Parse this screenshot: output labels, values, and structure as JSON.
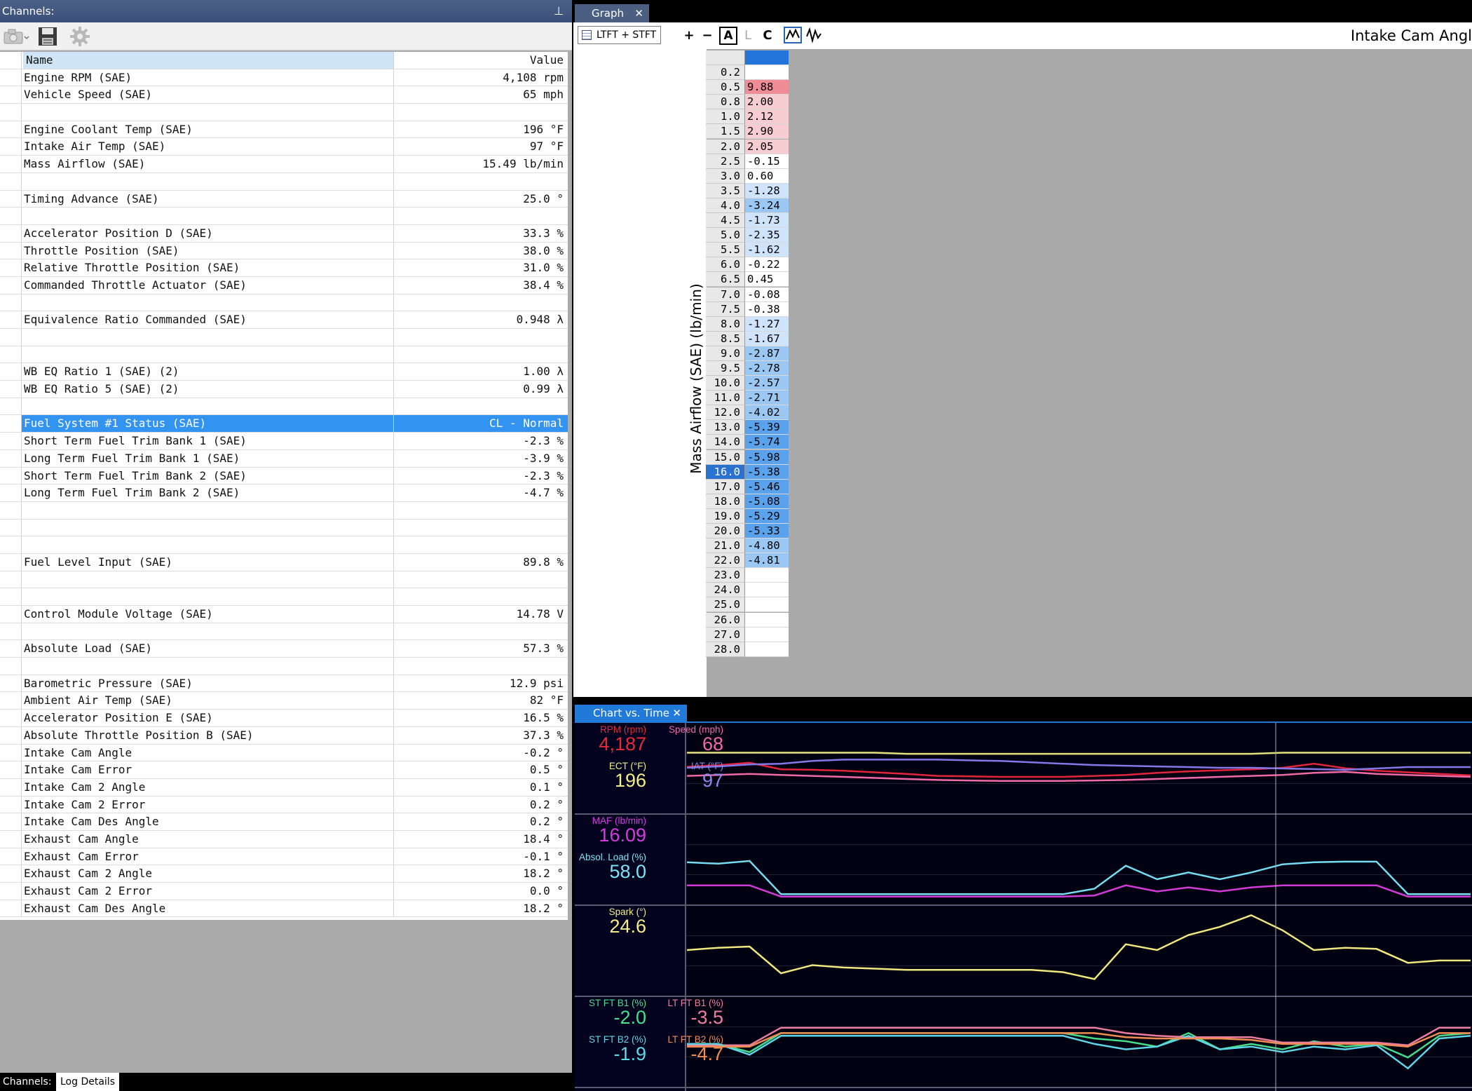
{
  "channels": {
    "title": "Channels:",
    "pin_glyph": "⊥",
    "toolbar_icons": [
      "camera-icon",
      "save-icon",
      "gear-icon"
    ],
    "header": {
      "name": "Name",
      "value": "Value"
    },
    "rows": [
      {
        "name": "Engine RPM (SAE)",
        "value": "4,108 rpm"
      },
      {
        "name": "Vehicle Speed (SAE)",
        "value": "65 mph"
      },
      {
        "name": "",
        "value": ""
      },
      {
        "name": "Engine Coolant Temp (SAE)",
        "value": "196 °F"
      },
      {
        "name": "Intake Air Temp (SAE)",
        "value": "97 °F"
      },
      {
        "name": "Mass Airflow (SAE)",
        "value": "15.49 lb/min"
      },
      {
        "name": "",
        "value": ""
      },
      {
        "name": "Timing Advance (SAE)",
        "value": "25.0 °"
      },
      {
        "name": "",
        "value": ""
      },
      {
        "name": "Accelerator Position D (SAE)",
        "value": "33.3 %"
      },
      {
        "name": "Throttle Position (SAE)",
        "value": "38.0 %"
      },
      {
        "name": "Relative Throttle Position (SAE)",
        "value": "31.0 %"
      },
      {
        "name": "Commanded Throttle Actuator (SAE)",
        "value": "38.4 %"
      },
      {
        "name": "",
        "value": ""
      },
      {
        "name": "Equivalence Ratio Commanded (SAE)",
        "value": "0.948 λ"
      },
      {
        "name": "",
        "value": ""
      },
      {
        "name": "",
        "value": ""
      },
      {
        "name": "WB EQ Ratio 1 (SAE) (2)",
        "value": "1.00 λ"
      },
      {
        "name": "WB EQ Ratio 5 (SAE) (2)",
        "value": "0.99 λ"
      },
      {
        "name": "",
        "value": ""
      },
      {
        "name": "Fuel System #1 Status (SAE)",
        "value": "CL - Normal",
        "selected": true
      },
      {
        "name": "Short Term Fuel Trim Bank 1 (SAE)",
        "value": "-2.3 %"
      },
      {
        "name": "Long Term Fuel Trim Bank 1 (SAE)",
        "value": "-3.9 %"
      },
      {
        "name": "Short Term Fuel Trim Bank 2 (SAE)",
        "value": "-2.3 %"
      },
      {
        "name": "Long Term Fuel Trim Bank 2 (SAE)",
        "value": "-4.7 %"
      },
      {
        "name": "",
        "value": ""
      },
      {
        "name": "",
        "value": ""
      },
      {
        "name": "",
        "value": ""
      },
      {
        "name": "Fuel Level Input (SAE)",
        "value": "89.8 %"
      },
      {
        "name": "",
        "value": ""
      },
      {
        "name": "",
        "value": ""
      },
      {
        "name": "Control Module Voltage (SAE)",
        "value": "14.78 V"
      },
      {
        "name": "",
        "value": ""
      },
      {
        "name": "Absolute Load (SAE)",
        "value": "57.3 %"
      },
      {
        "name": "",
        "value": ""
      },
      {
        "name": "Barometric Pressure (SAE)",
        "value": "12.9 psi"
      },
      {
        "name": "Ambient Air Temp (SAE)",
        "value": "82 °F"
      },
      {
        "name": "Accelerator Position E (SAE)",
        "value": "16.5 %"
      },
      {
        "name": "Absolute Throttle Position B (SAE)",
        "value": "37.3 %"
      },
      {
        "name": "Intake Cam Angle",
        "value": "-0.2 °"
      },
      {
        "name": "Intake Cam Error",
        "value": "0.5 °"
      },
      {
        "name": "Intake Cam 2 Angle",
        "value": "0.1 °"
      },
      {
        "name": "Intake Cam 2 Error",
        "value": "0.2 °"
      },
      {
        "name": "Intake Cam Des Angle",
        "value": "0.2 °"
      },
      {
        "name": "Exhaust Cam Angle",
        "value": "18.4 °"
      },
      {
        "name": "Exhaust Cam Error",
        "value": "-0.1 °"
      },
      {
        "name": "Exhaust Cam 2 Angle",
        "value": "18.2 °"
      },
      {
        "name": "Exhaust Cam 2 Error",
        "value": "0.0 °"
      },
      {
        "name": "Exhaust Cam Des Angle",
        "value": "18.2 °"
      }
    ],
    "bottom_tabs": {
      "channels": "Channels:",
      "log_details": "Log Details"
    }
  },
  "graph": {
    "tab_label": "Graph",
    "close_glyph": "✕",
    "toolbar": {
      "map_button": "LTFT + STFT",
      "plus": "+",
      "minus": "−",
      "a": "A",
      "l": "L",
      "c": "C"
    },
    "title": "Intake Cam Angl",
    "y_axis_label": "Mass Airflow (SAE) (lb/min)",
    "colors": {
      "positive_strong": "#f08c95",
      "positive_light": "#f8cdd1",
      "negative_light": "#cfe3fa",
      "negative_mid": "#9ac8f3",
      "negative_strong": "#5aa3ec"
    },
    "rows": [
      {
        "x": "0.2",
        "v": ""
      },
      {
        "x": "0.5",
        "v": "9.88"
      },
      {
        "x": "0.8",
        "v": "2.00"
      },
      {
        "x": "1.0",
        "v": "2.12"
      },
      {
        "x": "1.5",
        "v": "2.90"
      },
      {
        "x": "2.0",
        "v": "2.05"
      },
      {
        "x": "2.5",
        "v": "-0.15"
      },
      {
        "x": "3.0",
        "v": "0.60"
      },
      {
        "x": "3.5",
        "v": "-1.28"
      },
      {
        "x": "4.0",
        "v": "-3.24"
      },
      {
        "x": "4.5",
        "v": "-1.73"
      },
      {
        "x": "5.0",
        "v": "-2.35"
      },
      {
        "x": "5.5",
        "v": "-1.62"
      },
      {
        "x": "6.0",
        "v": "-0.22"
      },
      {
        "x": "6.5",
        "v": "0.45"
      },
      {
        "x": "7.0",
        "v": "-0.08"
      },
      {
        "x": "7.5",
        "v": "-0.38"
      },
      {
        "x": "8.0",
        "v": "-1.27"
      },
      {
        "x": "8.5",
        "v": "-1.67"
      },
      {
        "x": "9.0",
        "v": "-2.87"
      },
      {
        "x": "9.5",
        "v": "-2.78"
      },
      {
        "x": "10.0",
        "v": "-2.57"
      },
      {
        "x": "11.0",
        "v": "-2.71"
      },
      {
        "x": "12.0",
        "v": "-4.02"
      },
      {
        "x": "13.0",
        "v": "-5.39"
      },
      {
        "x": "14.0",
        "v": "-5.74"
      },
      {
        "x": "15.0",
        "v": "-5.98"
      },
      {
        "x": "16.0",
        "v": "-5.38",
        "selected": true
      },
      {
        "x": "17.0",
        "v": "-5.46"
      },
      {
        "x": "18.0",
        "v": "-5.08"
      },
      {
        "x": "19.0",
        "v": "-5.29"
      },
      {
        "x": "20.0",
        "v": "-5.33"
      },
      {
        "x": "21.0",
        "v": "-4.80"
      },
      {
        "x": "22.0",
        "v": "-4.81"
      },
      {
        "x": "23.0",
        "v": ""
      },
      {
        "x": "24.0",
        "v": ""
      },
      {
        "x": "25.0",
        "v": ""
      },
      {
        "x": "26.0",
        "v": ""
      },
      {
        "x": "27.0",
        "v": ""
      },
      {
        "x": "28.0",
        "v": ""
      }
    ]
  },
  "chart_vs_time": {
    "tab_label": "Chart vs. Time",
    "close_glyph": "✕",
    "panes": [
      {
        "labels": [
          {
            "key": "rpm",
            "caption": "RPM (rpm)",
            "value": "4,187",
            "color": "#e8293a"
          },
          {
            "key": "speed",
            "caption": "Speed (mph)",
            "value": "68",
            "color": "#f26aa6"
          },
          {
            "key": "ect",
            "caption": "ECT (°F)",
            "value": "196",
            "color": "#f1ee8a"
          },
          {
            "key": "iat",
            "caption": "IAT (°F)",
            "value": "97",
            "color": "#8d88f0"
          }
        ]
      },
      {
        "labels": [
          {
            "key": "maf",
            "caption": "MAF (lb/min)",
            "value": "16.09",
            "color": "#d63be0"
          },
          {
            "key": "load",
            "caption": "Absol. Load (%)",
            "value": "58.0",
            "color": "#7fe3f5"
          }
        ]
      },
      {
        "labels": [
          {
            "key": "spark",
            "caption": "Spark (°)",
            "value": "24.6",
            "color": "#f4ec8c"
          }
        ]
      },
      {
        "labels": [
          {
            "key": "stft1",
            "caption": "ST FT B1 (%)",
            "value": "-2.0",
            "color": "#47e08d"
          },
          {
            "key": "ltft1",
            "caption": "LT FT B1 (%)",
            "value": "-3.5",
            "color": "#f07ea0"
          },
          {
            "key": "stft2",
            "caption": "ST FT B2 (%)",
            "value": "-1.9",
            "color": "#5fd9ea"
          },
          {
            "key": "ltft2",
            "caption": "LT FT B2 (%)",
            "value": "-4.7",
            "color": "#f28d52"
          }
        ]
      }
    ],
    "traces": {
      "ect": {
        "color": "#e4e07a",
        "pane": 0,
        "range": [
          150,
          220
        ],
        "values": [
          198,
          198,
          198,
          198,
          198,
          198,
          198,
          197,
          197,
          197,
          197,
          197,
          197,
          197,
          197,
          197,
          197,
          197,
          197,
          198,
          198,
          198,
          198,
          198,
          198,
          198
        ]
      },
      "rpm": {
        "color": "#e2253c",
        "pane": 0,
        "range": [
          0,
          8000
        ],
        "values": [
          4100,
          4250,
          4500,
          3850,
          3800,
          3700,
          3550,
          3400,
          3200,
          3150,
          3100,
          3100,
          3100,
          3200,
          3300,
          3500,
          3650,
          3750,
          3850,
          4000,
          4400,
          3950,
          3700,
          3550,
          3400,
          3250
        ]
      },
      "iat": {
        "color": "#8477e8",
        "pane": 0,
        "range": [
          40,
          160
        ],
        "values": [
          100,
          102,
          105,
          106,
          110,
          112,
          112,
          112,
          112,
          111,
          110,
          108,
          106,
          104,
          103,
          102,
          101,
          100,
          100,
          99,
          98,
          97,
          99,
          101,
          101,
          101
        ]
      },
      "speed": {
        "color": "#f06aa5",
        "pane": 0,
        "range": [
          0,
          160
        ],
        "values": [
          64,
          66,
          68,
          66,
          64,
          62,
          60,
          58,
          56,
          55,
          54,
          54,
          54,
          55,
          56,
          58,
          60,
          62,
          64,
          66,
          70,
          72,
          68,
          66,
          64,
          62
        ]
      },
      "load": {
        "color": "#76dcf0",
        "pane": 1,
        "range": [
          0,
          120
        ],
        "values": [
          55,
          53,
          57,
          8,
          8,
          8,
          8,
          8,
          8,
          8,
          8,
          8,
          8,
          16,
          50,
          30,
          40,
          30,
          40,
          52,
          55,
          56,
          56,
          8,
          8,
          8
        ]
      },
      "maf": {
        "color": "#d23ad8",
        "pane": 1,
        "range": [
          0,
          40
        ],
        "values": [
          7,
          7,
          7,
          1.5,
          1.5,
          1.5,
          1.5,
          1.5,
          1.5,
          1.5,
          1.5,
          1.5,
          1.5,
          2,
          7,
          4,
          6,
          4,
          6,
          7,
          7,
          7,
          7,
          1.5,
          1.5,
          1.5
        ]
      },
      "spark": {
        "color": "#f0e87e",
        "pane": 2,
        "range": [
          -10,
          60
        ],
        "values": [
          25,
          27,
          28,
          5,
          12,
          10,
          9,
          8,
          8,
          8,
          8,
          8,
          6,
          0,
          30,
          25,
          38,
          45,
          55,
          42,
          25,
          27,
          26,
          14,
          16,
          16
        ]
      },
      "stft1": {
        "color": "#45dc8a",
        "pane": 3,
        "range": [
          -30,
          30
        ],
        "values": [
          -2,
          -2,
          -8,
          6,
          6,
          6,
          6,
          6,
          6,
          6,
          6,
          6,
          6,
          2,
          0,
          -4,
          6,
          -6,
          -2,
          -6,
          0,
          -4,
          -2,
          -12,
          4,
          6
        ]
      },
      "ltft1": {
        "color": "#ec7da0",
        "pane": 3,
        "range": [
          -30,
          30
        ],
        "values": [
          -3,
          -3,
          -3,
          10,
          10,
          10,
          10,
          10,
          10,
          10,
          10,
          10,
          10,
          10,
          6,
          4,
          3,
          3,
          3,
          -1,
          -1,
          -1,
          -1,
          -3,
          10,
          10
        ]
      },
      "stft2": {
        "color": "#5ed6e8",
        "pane": 3,
        "range": [
          -30,
          30
        ],
        "values": [
          -2,
          -2,
          -10,
          4,
          4,
          4,
          4,
          4,
          4,
          4,
          4,
          4,
          4,
          -2,
          -6,
          -4,
          4,
          -6,
          -4,
          -8,
          -4,
          -6,
          -3,
          -20,
          2,
          4
        ]
      },
      "ltft2": {
        "color": "#ef8c50",
        "pane": 3,
        "range": [
          -30,
          30
        ],
        "values": [
          -4,
          -4,
          -4,
          6,
          6,
          6,
          6,
          6,
          6,
          6,
          6,
          6,
          6,
          6,
          3,
          2,
          2,
          2,
          1,
          -2,
          -2,
          -2,
          -2,
          -4,
          6,
          6
        ]
      }
    }
  }
}
